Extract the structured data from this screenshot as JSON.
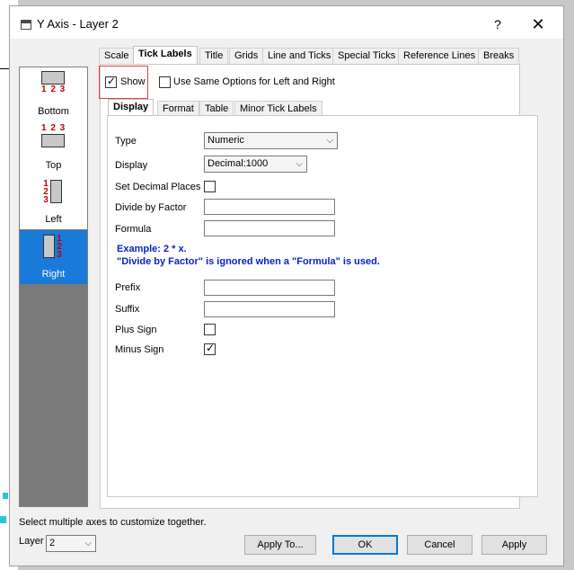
{
  "window": {
    "title": "Y Axis - Layer 2",
    "help": "?",
    "close": "✕"
  },
  "axes": [
    {
      "label": "Bottom",
      "nums": "1 2 3"
    },
    {
      "label": "Top",
      "nums": "1 2 3"
    },
    {
      "label": "Left",
      "nums": [
        "1",
        "2",
        "3"
      ]
    },
    {
      "label": "Right",
      "nums": [
        "1",
        "2",
        "3"
      ],
      "selected": true
    }
  ],
  "tabs": [
    "Scale",
    "Tick Labels",
    "Title",
    "Grids",
    "Line and Ticks",
    "Special Ticks",
    "Reference Lines",
    "Breaks"
  ],
  "active_tab": "Tick Labels",
  "show": {
    "label": "Show",
    "checked": true
  },
  "same_options": {
    "label": "Use Same Options for Left and Right",
    "checked": false
  },
  "subtabs": [
    "Display",
    "Format",
    "Table",
    "Minor Tick Labels"
  ],
  "active_subtab": "Display",
  "form": {
    "type_label": "Type",
    "type_value": "Numeric",
    "display_label": "Display",
    "display_value": "Decimal:1000",
    "set_decimal_label": "Set Decimal Places",
    "set_decimal_checked": false,
    "divide_label": "Divide by Factor",
    "divide_value": "",
    "formula_label": "Formula",
    "formula_value": "",
    "example_line1": "Example: 2 * x.",
    "example_line2": "\"Divide by Factor\" is ignored when a \"Formula\" is used.",
    "prefix_label": "Prefix",
    "prefix_value": "",
    "suffix_label": "Suffix",
    "suffix_value": "",
    "plus_label": "Plus Sign",
    "plus_checked": false,
    "minus_label": "Minus Sign",
    "minus_checked": true
  },
  "footer": {
    "hint": "Select multiple axes to customize together.",
    "layer_label": "Layer",
    "layer_value": "2",
    "apply_to": "Apply To...",
    "ok": "OK",
    "cancel": "Cancel",
    "apply": "Apply"
  },
  "colors": {
    "accent": "#0078d7",
    "selected": "#1a7ad9",
    "example_text": "#0a22c8",
    "highlight_box": "#e04040",
    "axis_numbers": "#c00000"
  }
}
